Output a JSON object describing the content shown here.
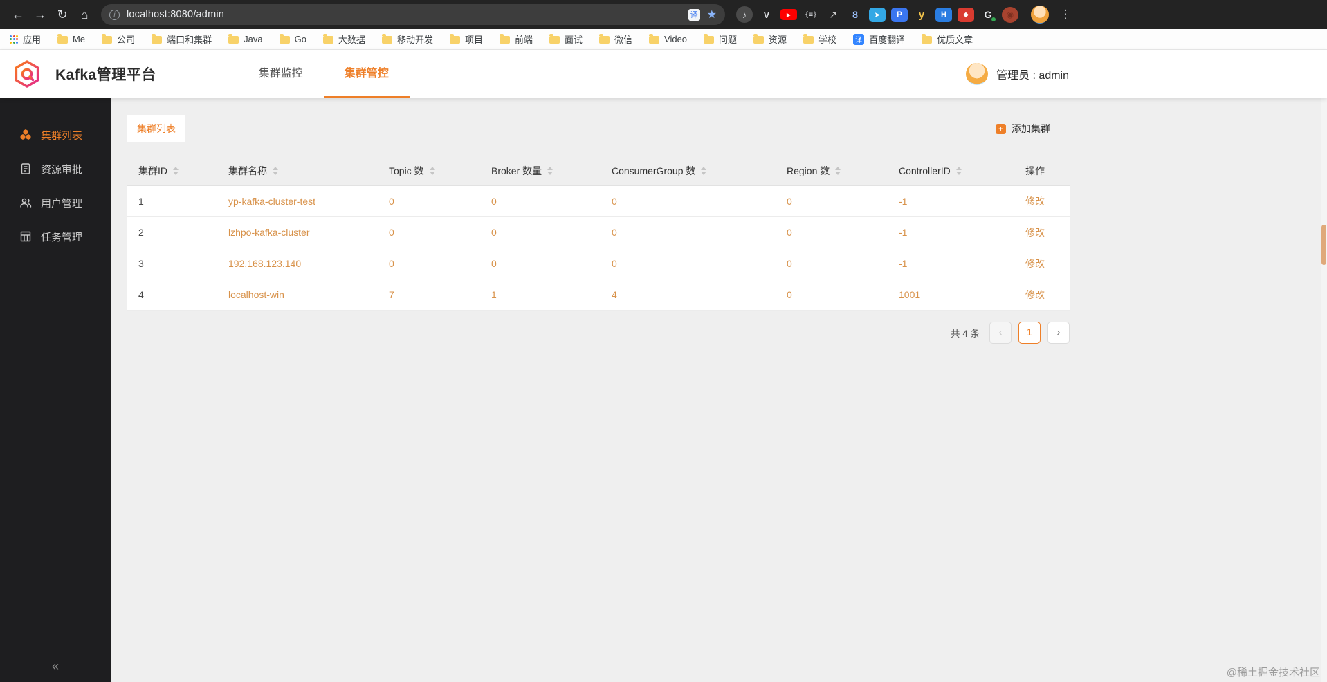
{
  "colors": {
    "accent": "#ee7f28",
    "link": "#d8924a",
    "toolbarBg": "#232323",
    "omniboxBg": "#3d3d3d",
    "sidebarBg": "#1e1e20",
    "contentBg": "#efefef"
  },
  "browser": {
    "nav": {
      "back": "←",
      "forward": "→",
      "refresh": "↻",
      "home": "⌂",
      "menu": "⋮"
    },
    "address": {
      "info": "i",
      "url": "localhost:8080/admin",
      "translate": "译",
      "star": "★"
    },
    "bookmarks": [
      {
        "label": "应用",
        "icon": "apps-grid-icon"
      },
      {
        "label": "Me",
        "icon": "folder-icon"
      },
      {
        "label": "公司",
        "icon": "folder-icon"
      },
      {
        "label": "端口和集群",
        "icon": "folder-icon"
      },
      {
        "label": "Java",
        "icon": "folder-icon"
      },
      {
        "label": "Go",
        "icon": "folder-icon"
      },
      {
        "label": "大数据",
        "icon": "folder-icon"
      },
      {
        "label": "移动开发",
        "icon": "folder-icon"
      },
      {
        "label": "项目",
        "icon": "folder-icon"
      },
      {
        "label": "前端",
        "icon": "folder-icon"
      },
      {
        "label": "面试",
        "icon": "folder-icon"
      },
      {
        "label": "微信",
        "icon": "folder-icon"
      },
      {
        "label": "Video",
        "icon": "folder-icon"
      },
      {
        "label": "问题",
        "icon": "folder-icon"
      },
      {
        "label": "资源",
        "icon": "folder-icon"
      },
      {
        "label": "学校",
        "icon": "folder-icon"
      },
      {
        "label": "百度翻译",
        "icon": "baidu-translate-icon"
      },
      {
        "label": "优质文章",
        "icon": "folder-icon"
      }
    ],
    "extensions": [
      {
        "name": "audio-extension-icon",
        "glyph": "♪"
      },
      {
        "name": "v-extension-icon",
        "glyph": "V"
      },
      {
        "name": "youtube-icon",
        "glyph": "▶"
      },
      {
        "name": "json-extension-icon",
        "glyph": "{≡}"
      },
      {
        "name": "route-extension-icon",
        "glyph": "↗"
      },
      {
        "name": "blue-8-extension-icon",
        "glyph": "8"
      },
      {
        "name": "telegram-extension-icon",
        "glyph": "➤"
      },
      {
        "name": "p-extension-icon",
        "glyph": "P"
      },
      {
        "name": "y-extension-icon",
        "glyph": "y"
      },
      {
        "name": "h-extension-icon",
        "glyph": "H"
      },
      {
        "name": "red-extension-icon",
        "glyph": "◆"
      },
      {
        "name": "g-extension-icon",
        "glyph": "G"
      },
      {
        "name": "octopus-extension-icon",
        "glyph": "◉"
      }
    ]
  },
  "header": {
    "title": "Kafka管理平台",
    "tabs": [
      {
        "label": "集群监控",
        "active": false
      },
      {
        "label": "集群管控",
        "active": true
      }
    ],
    "user": "管理员 : admin"
  },
  "sidebar": {
    "items": [
      {
        "label": "集群列表",
        "active": true
      },
      {
        "label": "资源审批",
        "active": false
      },
      {
        "label": "用户管理",
        "active": false
      },
      {
        "label": "任务管理",
        "active": false
      }
    ],
    "collapse": "«"
  },
  "main": {
    "tab": "集群列表",
    "add_button": "添加集群",
    "add_icon": "+",
    "table": {
      "columns": [
        "集群ID",
        "集群名称",
        "Topic 数",
        "Broker 数量",
        "ConsumerGroup 数",
        "Region 数",
        "ControllerID",
        "操作"
      ],
      "rows": [
        [
          "1",
          "yp-kafka-cluster-test",
          "0",
          "0",
          "0",
          "0",
          "-1",
          "修改"
        ],
        [
          "2",
          "lzhpo-kafka-cluster",
          "0",
          "0",
          "0",
          "0",
          "-1",
          "修改"
        ],
        [
          "3",
          "192.168.123.140",
          "0",
          "0",
          "0",
          "0",
          "-1",
          "修改"
        ],
        [
          "4",
          "localhost-win",
          "7",
          "1",
          "4",
          "0",
          "1001",
          "修改"
        ]
      ]
    },
    "pagination": {
      "total": "共 4 条",
      "prev": "‹",
      "page": "1",
      "next": "›"
    }
  },
  "watermark": "@稀土掘金技术社区"
}
